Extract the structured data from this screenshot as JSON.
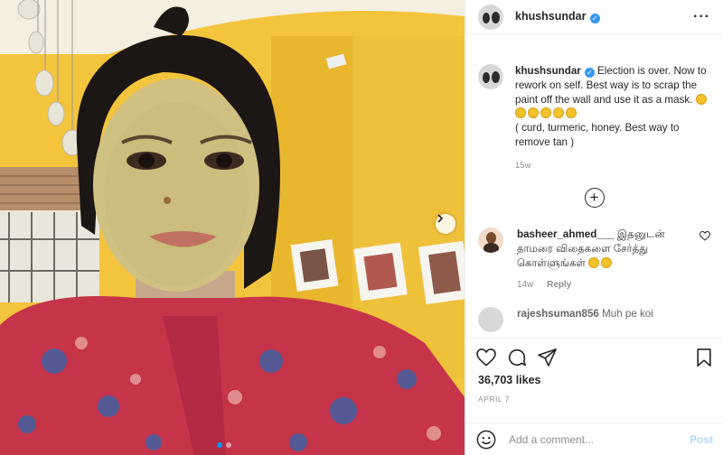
{
  "post": {
    "username": "khushsundar",
    "verified": true,
    "more_icon": "more-horizontal-icon",
    "caption_text": "Election is over. Now to rework on self. Best way is to scrap the paint off the wall and use it as a mask.",
    "caption_text2": "( curd, turmeric, honey. Best way to remove tan )",
    "caption_emoji_count": 6,
    "caption_time": "15w",
    "load_more_icon": "plus-circle-icon"
  },
  "comments": [
    {
      "username": "basheer_ahmed___",
      "text": "இதனுடன் தாமரை விதைகளை சேர்த்து கொள்ளுங்கள்",
      "time": "14w",
      "reply_label": "Reply"
    },
    {
      "username": "rajeshsuman856",
      "text": "Muh pe koi"
    }
  ],
  "actions": {
    "like_icon": "heart-icon",
    "comment_icon": "comment-icon",
    "share_icon": "send-icon",
    "save_icon": "bookmark-icon"
  },
  "likes": "36,703 likes",
  "date": "APRIL 7",
  "add_comment": {
    "placeholder": "Add a comment...",
    "post_label": "Post",
    "emoji_icon": "smiley-icon"
  },
  "carousel": {
    "next_icon": "chevron-right-icon",
    "active_index": 0,
    "count": 2
  },
  "colors": {
    "verified_blue": "#3897f0",
    "post_link": "#b3dbff",
    "secondary_text": "#8e8e8e"
  }
}
